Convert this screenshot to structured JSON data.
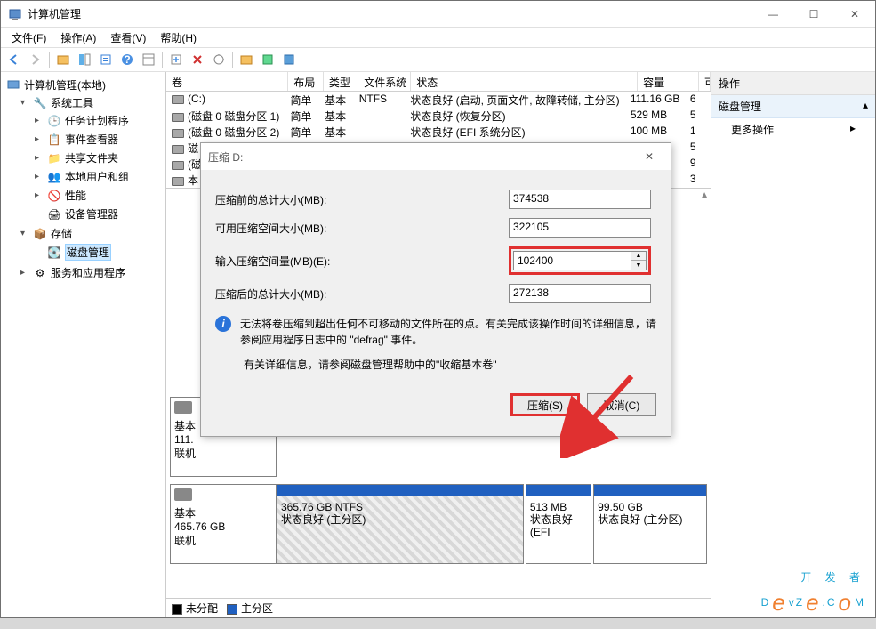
{
  "titlebar": {
    "title": "计算机管理"
  },
  "menubar": [
    "文件(F)",
    "操作(A)",
    "查看(V)",
    "帮助(H)"
  ],
  "tree": {
    "root": "计算机管理(本地)",
    "system_tools": "系统工具",
    "task_scheduler": "任务计划程序",
    "event_viewer": "事件查看器",
    "shared_folders": "共享文件夹",
    "local_users": "本地用户和组",
    "performance": "性能",
    "device_manager": "设备管理器",
    "storage": "存储",
    "disk_management": "磁盘管理",
    "services_apps": "服务和应用程序"
  },
  "grid": {
    "headers": {
      "volume": "卷",
      "layout": "布局",
      "type": "类型",
      "fs": "文件系统",
      "status": "状态",
      "capacity": "容量",
      "free": "可"
    },
    "rows": [
      {
        "volume": "(C:)",
        "layout": "简单",
        "type": "基本",
        "fs": "NTFS",
        "status": "状态良好 (启动, 页面文件, 故障转储, 主分区)",
        "capacity": "111.16 GB",
        "free": "6"
      },
      {
        "volume": "(磁盘 0 磁盘分区 1)",
        "layout": "简单",
        "type": "基本",
        "fs": "",
        "status": "状态良好 (恢复分区)",
        "capacity": "529 MB",
        "free": "5"
      },
      {
        "volume": "(磁盘 0 磁盘分区 2)",
        "layout": "简单",
        "type": "基本",
        "fs": "",
        "status": "状态良好 (EFI 系统分区)",
        "capacity": "100 MB",
        "free": "1"
      },
      {
        "volume": "磁",
        "layout": "",
        "type": "",
        "fs": "",
        "status": "",
        "capacity": "B",
        "free": "5"
      },
      {
        "volume": "(磁",
        "layout": "",
        "type": "",
        "fs": "",
        "status": "",
        "capacity": "B",
        "free": "9"
      },
      {
        "volume": "本",
        "layout": "",
        "type": "",
        "fs": "",
        "status": "",
        "capacity": "GB",
        "free": "3"
      }
    ]
  },
  "disks": {
    "d0": {
      "label": "基本",
      "size": "111.",
      "status": "联机"
    },
    "d1": {
      "label": "基本",
      "size": "465.76 GB",
      "status": "联机",
      "parts": [
        {
          "size": "365.76 GB NTFS",
          "status": "状态良好 (主分区)",
          "hatch": true
        },
        {
          "size": "513 MB",
          "status": "状态良好 (EFI"
        },
        {
          "size": "99.50 GB",
          "status": "状态良好 (主分区)"
        }
      ]
    }
  },
  "legend": {
    "unalloc": "未分配",
    "primary": "主分区"
  },
  "actions": {
    "header": "操作",
    "disk_mgmt": "磁盘管理",
    "more": "更多操作"
  },
  "dialog": {
    "title": "压缩 D:",
    "total_before_label": "压缩前的总计大小(MB):",
    "total_before": "374538",
    "avail_label": "可用压缩空间大小(MB):",
    "avail": "322105",
    "input_label": "输入压缩空间量(MB)(E):",
    "input_value": "102400",
    "total_after_label": "压缩后的总计大小(MB):",
    "total_after": "272138",
    "info": "无法将卷压缩到超出任何不可移动的文件所在的点。有关完成该操作时间的详细信息，请参阅应用程序日志中的 \"defrag\" 事件。",
    "help": "有关详细信息，请参阅磁盘管理帮助中的\"收缩基本卷\"",
    "shrink_btn": "压缩(S)",
    "cancel_btn": "取消(C)"
  },
  "watermark": {
    "line1": "开 发 者",
    "line2": "DevZe.CoM"
  }
}
